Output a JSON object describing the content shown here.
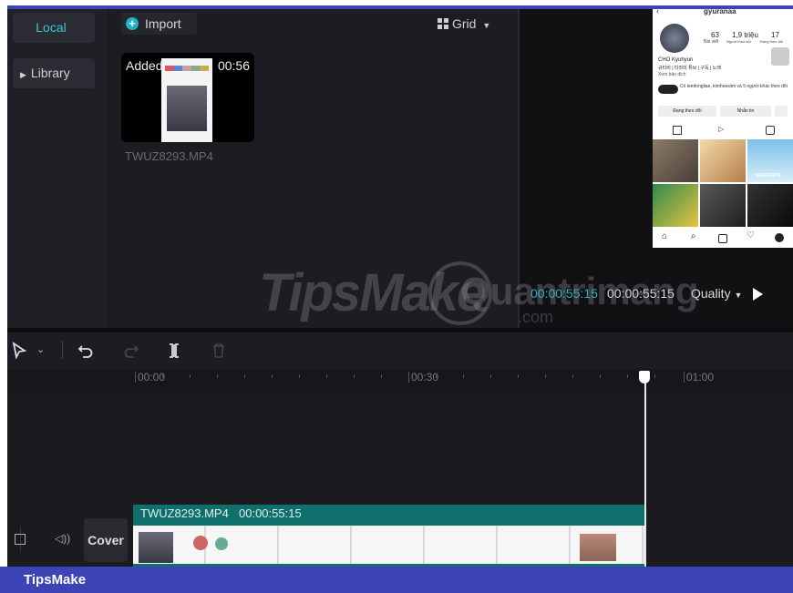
{
  "nav": {
    "local_label": "Local",
    "library_label": "Library"
  },
  "media": {
    "import_label": "Import",
    "grid_label": "Grid",
    "clip_added_label": "Added",
    "clip_duration": "00:56",
    "clip_filename": "TWUZ8293.MP4"
  },
  "preview": {
    "current_time": "00:00:55:15",
    "total_time": "00:00:55:15",
    "quality_label": "Quality",
    "phone": {
      "username": "gyuranaa",
      "posts_count": "63",
      "posts_label": "Bài viết",
      "followers_count": "1,9 triệu",
      "followers_label": "Người theo dõi",
      "following_count": "17",
      "following_label": "Đang theo dõi",
      "profile_name": "CHO Kyuhyun",
      "bio_line": "규티비 | 티라미 튜브 | 구독 | 노래",
      "translate_label": "Xem bản dịch",
      "followed_by": "Có leedongliae, kimheesiim và 5 người khác theo dõi",
      "following_button": "Đang theo dõi",
      "message_button": "Nhắn tin",
      "festa_label": "NEWFESTA"
    }
  },
  "ruler": {
    "t0": "00:00",
    "t1": "00:30",
    "t2": "01:00"
  },
  "timeline": {
    "clip_filename": "TWUZ8293.MP4",
    "clip_duration": "00:00:55:15",
    "cover_label": "Cover"
  },
  "watermark": {
    "text1": "TipsMake",
    "text2": "Quantrimang",
    "text3": ".com"
  },
  "footer": {
    "brand": "TipsMake"
  },
  "colors": {
    "accent_teal": "#1fb3c3",
    "clip_band": "#0f6f6a",
    "footer_blue": "#3d44b5"
  }
}
